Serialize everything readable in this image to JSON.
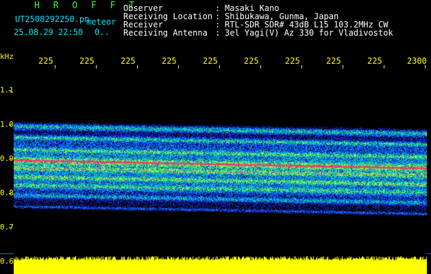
{
  "header": {
    "station": "H R O F F T",
    "filename": "UT2508292250.pn",
    "suffix": "meteor",
    "datetime": "25.08.29 22:50",
    "counter": "0..",
    "fields": [
      {
        "label": "Observer",
        "sep": ":",
        "value": "Masaki Kano"
      },
      {
        "label": "Receiving Location",
        "sep": ":",
        "value": "Shibukawa, Gunma, Japan"
      },
      {
        "label": "Receiver",
        "sep": ":",
        "value": "RTL-SDR SDR# 43dB L15 103.2MHz CW"
      },
      {
        "label": "Receiving Antenna",
        "sep": ":",
        "value": "3el Yagi(V) Az 330 for Vladivostok"
      }
    ]
  },
  "axis": {
    "y_unit": "kHz",
    "y_labels": [
      "1.1",
      "1.0",
      "0.9",
      "0.8",
      "0.7",
      "0.6"
    ],
    "x_labels": [
      "225",
      "225",
      "225",
      "225",
      "225",
      "225",
      "225",
      "225",
      "225",
      "2300"
    ]
  },
  "colors": {
    "axis_text": "#ffff00",
    "header_text": "#ffffff",
    "station_text": "#33ff33",
    "filename_text": "#00e5ff",
    "signal_strip": "#ffff00",
    "background": "#000000"
  }
}
